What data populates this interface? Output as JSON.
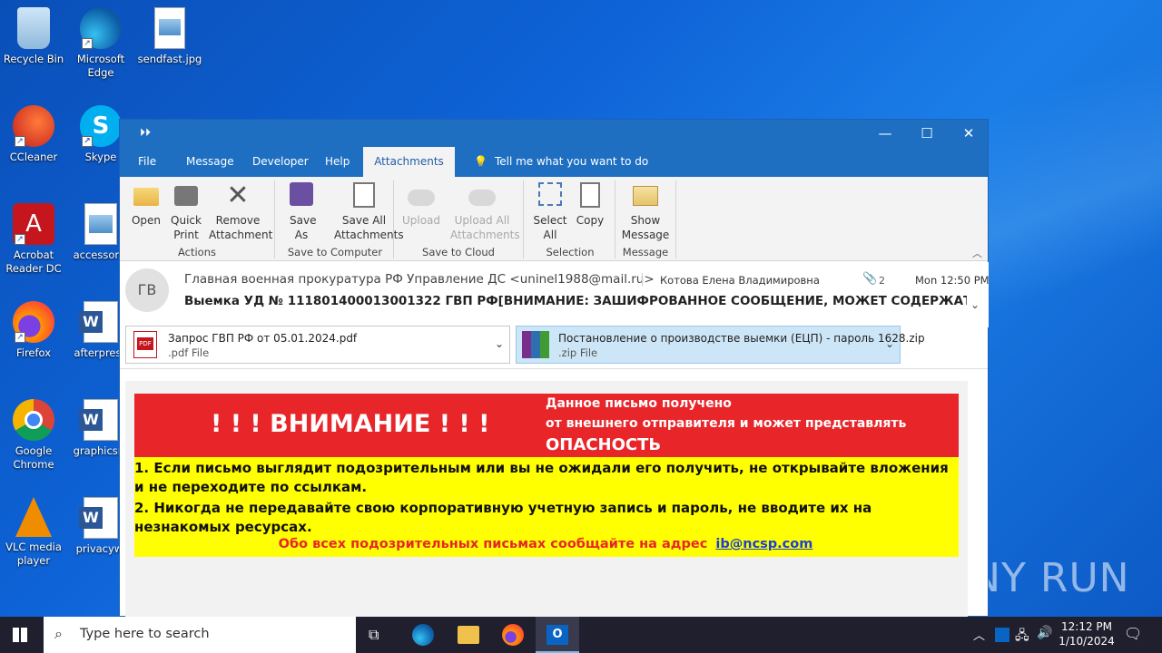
{
  "desktop": {
    "icons": [
      {
        "label": "Recycle Bin"
      },
      {
        "label": "Microsoft Edge"
      },
      {
        "label": "sendfast.jpg"
      },
      {
        "label": "CCleaner"
      },
      {
        "label": "Skype"
      },
      {
        "label": "Acrobat Reader DC"
      },
      {
        "label": "accessorie"
      },
      {
        "label": "Firefox"
      },
      {
        "label": "afterprese"
      },
      {
        "label": "Google Chrome"
      },
      {
        "label": "graphicsre"
      },
      {
        "label": "VLC media player"
      },
      {
        "label": "privacywi"
      }
    ],
    "watermark": "ANY RUN"
  },
  "window": {
    "quick_access": "⏵⏵",
    "tabs": [
      {
        "label": "File"
      },
      {
        "label": "Message"
      },
      {
        "label": "Developer"
      },
      {
        "label": "Help"
      },
      {
        "label": "Attachments",
        "active": true
      }
    ],
    "tell_me": "Tell me what you want to do",
    "ribbon": {
      "open": "Open",
      "quick_print": "Quick Print",
      "remove": "Remove Attachment",
      "group_actions": "Actions",
      "save_as": "Save As",
      "save_all": "Save All Attachments",
      "group_save": "Save to Computer",
      "upload": "Upload",
      "upload_all": "Upload All Attachments",
      "group_cloud": "Save to Cloud",
      "select_all": "Select All",
      "copy": "Copy",
      "group_selection": "Selection",
      "show_message": "Show Message",
      "group_message": "Message"
    },
    "message": {
      "avatar": "ГВ",
      "from": "Главная военная прокуратура РФ Управление ДС <uninel1988@mail.ru>",
      "to": "Котова Елена Владимировна",
      "attachments_count": "2",
      "date": "Mon 12:50 PM",
      "subject": "Выемка УД № 111801400013001322  ГВП РФ[ВНИМАНИЕ: ЗАШИФРОВАННОЕ СООБЩЕНИЕ, МОЖЕТ СОДЕРЖАТЬ ВИРУСЫ!",
      "attachments": [
        {
          "name": "Запрос ГВП РФ от 05.01.2024.pdf",
          "type": ".pdf File"
        },
        {
          "name": "Постановление о производстве выемки (ЕЦП) - пароль 1628.zip",
          "type": ".zip File"
        }
      ]
    },
    "banner": {
      "title": "! ! ! ВНИМАНИЕ ! ! !",
      "side_line1": "Данное письмо получено",
      "side_line2": "от внешнего отправителя и может представлять",
      "side_line3": "ОПАСНОСТЬ",
      "item1": "1. Если письмо выглядит подозрительным или вы не ожидали его получить, не открывайте вложения и не переходите по ссылкам.",
      "item2": "2. Никогда не передавайте свою корпоративную учетную запись и пароль, не вводите их на незнакомых ресурсах.",
      "report": "Обо всех подозрительных письмах сообщайте на адрес",
      "report_email": "ib@ncsp.com"
    }
  },
  "taskbar": {
    "search_placeholder": "Type here to search",
    "time": "12:12 PM",
    "date": "1/10/2024"
  },
  "colors": {
    "outlook_blue": "#1e6fc2",
    "banner_red": "#e8262a",
    "banner_yellow": "#ffff00"
  }
}
